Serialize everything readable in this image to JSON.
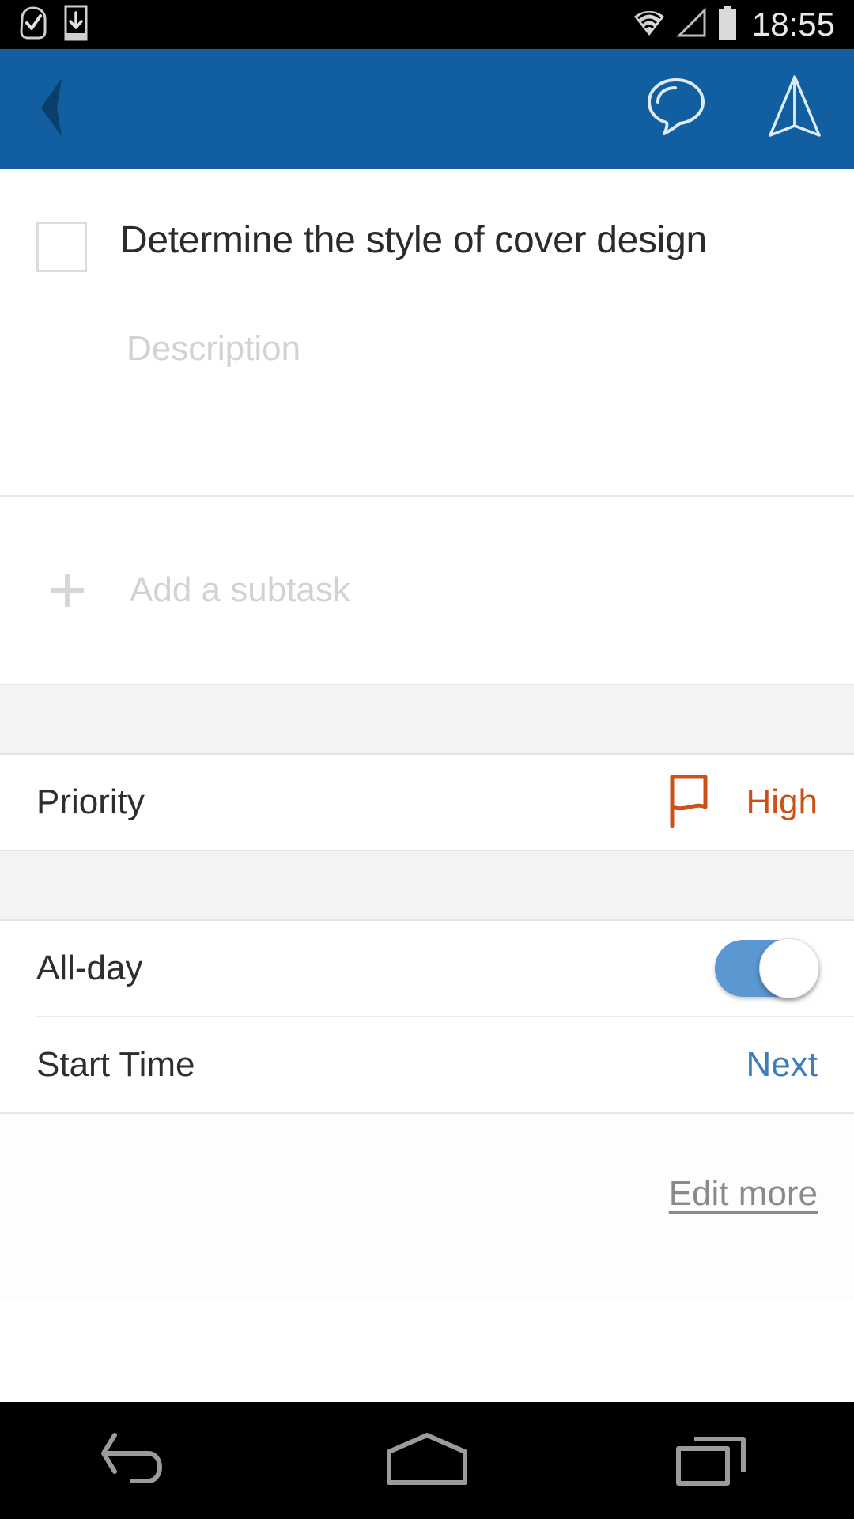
{
  "status_bar": {
    "time": "18:55",
    "left_icons": [
      {
        "name": "task-check-notification-icon"
      },
      {
        "name": "download-notification-icon"
      }
    ],
    "right_icons": [
      {
        "name": "wifi-icon"
      },
      {
        "name": "cellular-signal-icon"
      },
      {
        "name": "battery-icon"
      }
    ],
    "background_color": "#000000",
    "text_color": "#e8e8e8"
  },
  "toolbar": {
    "background_color": "#115FA0",
    "back_icon": "back-chevron-icon",
    "comment_icon": "comment-bubble-icon",
    "send_icon": "send-paper-plane-icon"
  },
  "task": {
    "title": "Determine the style of cover design",
    "completed": false,
    "description_placeholder": "Description",
    "subtask_placeholder": "Add a subtask",
    "add_subtask_icon": "plus-icon"
  },
  "fields": {
    "priority": {
      "label": "Priority",
      "value": "High",
      "icon": "flag-icon",
      "color": "#CE5015"
    },
    "all_day": {
      "label": "All-day",
      "enabled": true,
      "track_color": "#5B97D0"
    },
    "start_time": {
      "label": "Start Time",
      "value": "Next",
      "color": "#3C7EBC"
    }
  },
  "footer": {
    "edit_more_label": "Edit more"
  },
  "nav_bar": {
    "background_color": "#000000",
    "buttons": [
      {
        "name": "nav-back-button"
      },
      {
        "name": "nav-home-button"
      },
      {
        "name": "nav-recents-button"
      }
    ]
  }
}
